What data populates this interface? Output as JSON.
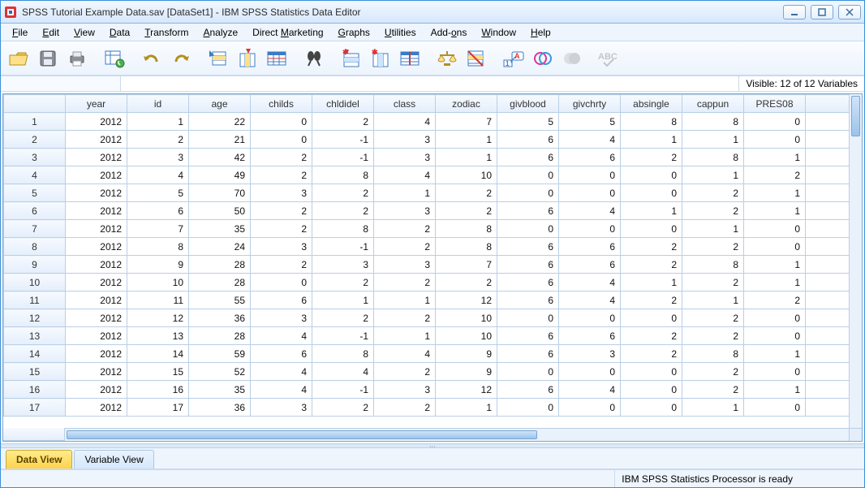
{
  "window": {
    "title": "SPSS Tutorial Example Data.sav [DataSet1] - IBM SPSS Statistics Data Editor"
  },
  "menu": [
    "File",
    "Edit",
    "View",
    "Data",
    "Transform",
    "Analyze",
    "Direct Marketing",
    "Graphs",
    "Utilities",
    "Add-ons",
    "Window",
    "Help"
  ],
  "menu_accel": [
    0,
    0,
    0,
    0,
    0,
    0,
    7,
    0,
    0,
    4,
    0,
    0
  ],
  "visible_text": "Visible: 12 of 12 Variables",
  "columns": [
    "year",
    "id",
    "age",
    "childs",
    "chldidel",
    "class",
    "zodiac",
    "givblood",
    "givchrty",
    "absingle",
    "cappun",
    "PRES08"
  ],
  "rows": [
    {
      "n": 1,
      "v": [
        2012,
        1,
        22,
        0,
        2,
        4,
        7,
        5,
        5,
        8,
        8,
        0
      ]
    },
    {
      "n": 2,
      "v": [
        2012,
        2,
        21,
        0,
        -1,
        3,
        1,
        6,
        4,
        1,
        1,
        0
      ]
    },
    {
      "n": 3,
      "v": [
        2012,
        3,
        42,
        2,
        -1,
        3,
        1,
        6,
        6,
        2,
        8,
        1
      ]
    },
    {
      "n": 4,
      "v": [
        2012,
        4,
        49,
        2,
        8,
        4,
        10,
        0,
        0,
        0,
        1,
        2
      ]
    },
    {
      "n": 5,
      "v": [
        2012,
        5,
        70,
        3,
        2,
        1,
        2,
        0,
        0,
        0,
        2,
        1
      ]
    },
    {
      "n": 6,
      "v": [
        2012,
        6,
        50,
        2,
        2,
        3,
        2,
        6,
        4,
        1,
        2,
        1
      ]
    },
    {
      "n": 7,
      "v": [
        2012,
        7,
        35,
        2,
        8,
        2,
        8,
        0,
        0,
        0,
        1,
        0
      ]
    },
    {
      "n": 8,
      "v": [
        2012,
        8,
        24,
        3,
        -1,
        2,
        8,
        6,
        6,
        2,
        2,
        0
      ]
    },
    {
      "n": 9,
      "v": [
        2012,
        9,
        28,
        2,
        3,
        3,
        7,
        6,
        6,
        2,
        8,
        1
      ]
    },
    {
      "n": 10,
      "v": [
        2012,
        10,
        28,
        0,
        2,
        2,
        2,
        6,
        4,
        1,
        2,
        1
      ]
    },
    {
      "n": 11,
      "v": [
        2012,
        11,
        55,
        6,
        1,
        1,
        12,
        6,
        4,
        2,
        1,
        2
      ]
    },
    {
      "n": 12,
      "v": [
        2012,
        12,
        36,
        3,
        2,
        2,
        10,
        0,
        0,
        0,
        2,
        0
      ]
    },
    {
      "n": 13,
      "v": [
        2012,
        13,
        28,
        4,
        -1,
        1,
        10,
        6,
        6,
        2,
        2,
        0
      ]
    },
    {
      "n": 14,
      "v": [
        2012,
        14,
        59,
        6,
        8,
        4,
        9,
        6,
        3,
        2,
        8,
        1
      ]
    },
    {
      "n": 15,
      "v": [
        2012,
        15,
        52,
        4,
        4,
        2,
        9,
        0,
        0,
        0,
        2,
        0
      ]
    },
    {
      "n": 16,
      "v": [
        2012,
        16,
        35,
        4,
        -1,
        3,
        12,
        6,
        4,
        0,
        2,
        1
      ]
    },
    {
      "n": 17,
      "v": [
        2012,
        17,
        36,
        3,
        2,
        2,
        1,
        0,
        0,
        0,
        1,
        0
      ]
    }
  ],
  "tabs": {
    "data_view": "Data View",
    "variable_view": "Variable View"
  },
  "status": "IBM SPSS Statistics Processor is ready",
  "icons": [
    "open",
    "save",
    "print",
    "table-opts",
    "undo",
    "redo",
    "goto-case",
    "goto-var",
    "variables",
    "find",
    "insert-case",
    "insert-var",
    "split",
    "weight",
    "select",
    "value-labels",
    "sets",
    "sets-disabled",
    "spell"
  ]
}
